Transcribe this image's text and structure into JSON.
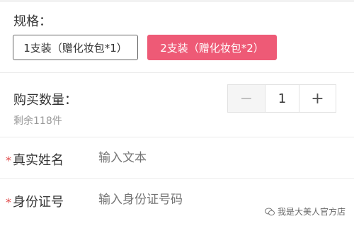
{
  "spec": {
    "title": "规格：",
    "options": [
      {
        "label": "1支装（赠化妆包*1）",
        "selected": false
      },
      {
        "label": "2支装（赠化妆包*2）",
        "selected": true
      }
    ]
  },
  "quantity": {
    "label": "购买数量：",
    "stock": "剩余118件",
    "value": "1",
    "minus": "−",
    "plus": "+"
  },
  "form": {
    "name_label": "真实姓名",
    "name_placeholder": "输入文本",
    "id_label": "身份证号",
    "id_placeholder": "输入身份证号码",
    "required_mark": "*"
  },
  "watermark": "我是大美人官方店",
  "colors": {
    "accent": "#ee5a76",
    "required": "#e04b4b"
  }
}
